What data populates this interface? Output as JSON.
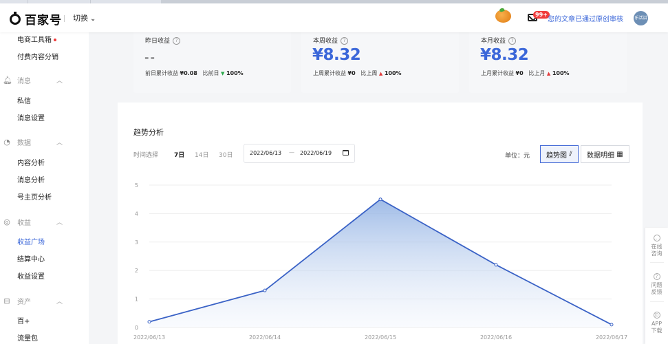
{
  "header": {
    "logo_text": "百家号",
    "switch_label": "切换",
    "badge": "99+",
    "notice": "您的文章已通过原创审核",
    "avatar_text": "乐活\n讲堂"
  },
  "sidebar": {
    "items_top": [
      "电商工具箱",
      "付费内容分销"
    ],
    "sections": [
      {
        "title": "消息",
        "items": [
          "私信",
          "消息设置"
        ]
      },
      {
        "title": "数据",
        "items": [
          "内容分析",
          "消息分析",
          "号主页分析"
        ]
      },
      {
        "title": "收益",
        "items": [
          "收益广场",
          "结算中心",
          "收益设置"
        ]
      },
      {
        "title": "资产",
        "items": [
          "百+",
          "流量包"
        ]
      }
    ]
  },
  "cards": [
    {
      "label": "昨日收益",
      "value": "--",
      "foot_label": "前日累计收益",
      "foot_value": "¥0.08",
      "cmp_label": "比前日",
      "cmp_value": "100%",
      "trend": "down"
    },
    {
      "label": "本周收益",
      "value": "¥8.32",
      "foot_label": "上周累计收益",
      "foot_value": "¥0",
      "cmp_label": "比上周",
      "cmp_value": "100%",
      "trend": "up"
    },
    {
      "label": "本月收益",
      "value": "¥8.32",
      "foot_label": "上月累计收益",
      "foot_value": "¥0",
      "cmp_label": "比上月",
      "cmp_value": "100%",
      "trend": "up"
    }
  ],
  "trend": {
    "title": "趋势分析",
    "time_label": "时间选择",
    "ranges": [
      "7日",
      "14日",
      "30日"
    ],
    "date_start": "2022/06/13",
    "date_sep": "—",
    "date_end": "2022/06/19",
    "unit": "单位：元",
    "view_chart": "趋势图",
    "view_table": "数据明细"
  },
  "float": {
    "consult": "在线\n咨询",
    "feedback": "问题\n反馈",
    "app": "APP\n下载"
  },
  "colors": {
    "accent": "#3b67d9",
    "line": "#3a62c6",
    "up": "#e23b3b",
    "down": "#2aa84a"
  },
  "chart_data": {
    "type": "area",
    "x": [
      "2022/06/13",
      "2022/06/14",
      "2022/06/15",
      "2022/06/16",
      "2022/06/17"
    ],
    "series": [
      {
        "values": [
          0.2,
          1.3,
          4.5,
          2.2,
          0.1
        ]
      }
    ],
    "ylim": [
      0,
      5
    ],
    "yticks": [
      0,
      1,
      2,
      3,
      4,
      5
    ],
    "grid": true
  }
}
